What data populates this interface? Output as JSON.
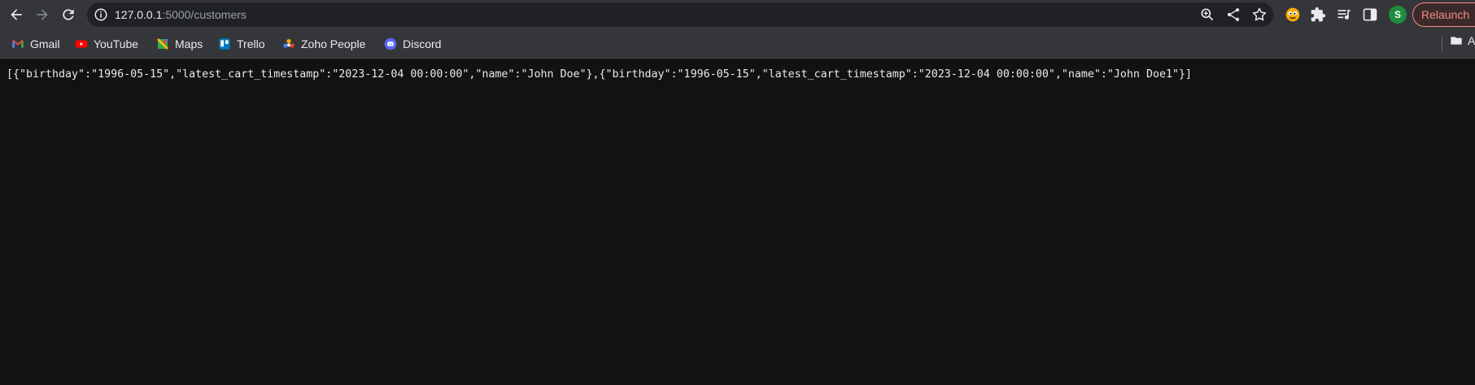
{
  "browser": {
    "url_host": "127.0.0.1",
    "url_path": ":5000/customers",
    "relaunch_label": "Relaunch",
    "profile_initial": "S"
  },
  "bookmarks": [
    {
      "label": "Gmail",
      "icon": "gmail-icon"
    },
    {
      "label": "YouTube",
      "icon": "youtube-icon"
    },
    {
      "label": "Maps",
      "icon": "maps-icon"
    },
    {
      "label": "Trello",
      "icon": "trello-icon"
    },
    {
      "label": "Zoho People",
      "icon": "zoho-people-icon"
    },
    {
      "label": "Discord",
      "icon": "discord-icon"
    }
  ],
  "other_bookmarks_label": "A",
  "page": {
    "json_text": "[{\"birthday\":\"1996-05-15\",\"latest_cart_timestamp\":\"2023-12-04 00:00:00\",\"name\":\"John Doe\"},{\"birthday\":\"1996-05-15\",\"latest_cart_timestamp\":\"2023-12-04 00:00:00\",\"name\":\"John Doe1\"}]"
  },
  "colors": {
    "toolbar_bg": "#35363a",
    "omnibox_bg": "#202124",
    "page_bg": "#121212",
    "relaunch_accent": "#f28b82",
    "avatar_bg": "#1e8e3e"
  }
}
